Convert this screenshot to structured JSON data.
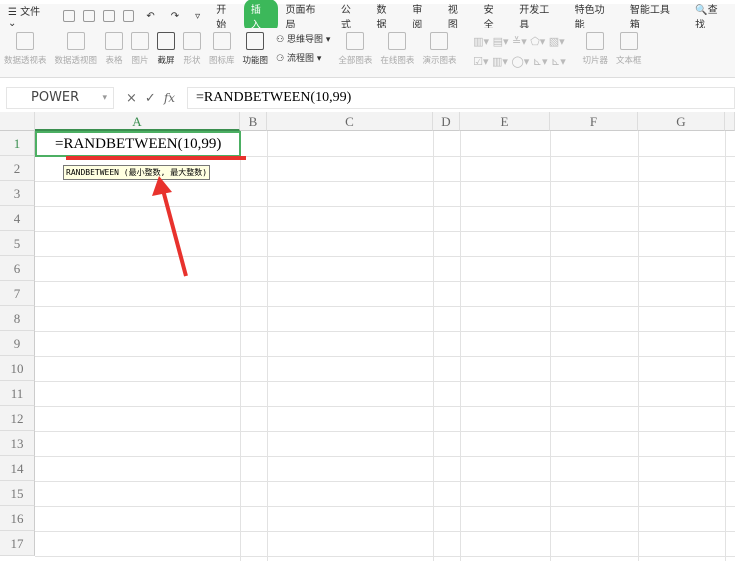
{
  "menu": {
    "file": "文件",
    "tabs": [
      "开始",
      "插入",
      "页面布局",
      "公式",
      "数据",
      "审阅",
      "视图",
      "安全",
      "开发工具",
      "特色功能",
      "智能工具箱"
    ],
    "active_tab": "插入",
    "search": "查找"
  },
  "ribbon": {
    "items": [
      "数据透视表",
      "数据透视图",
      "表格",
      "图片",
      "截屏",
      "形状",
      "图标库",
      "功能图"
    ],
    "mind_map": "思维导图",
    "flowchart": "流程图",
    "chart_items": [
      "全部图表",
      "在线图表",
      "演示图表"
    ],
    "slicer": "切片器",
    "textbox": "文本框"
  },
  "formula_bar": {
    "name_box": "POWER",
    "cancel": "×",
    "confirm": "✓",
    "fx": "fx",
    "formula": "=RANDBETWEEN(10,99)"
  },
  "columns": [
    "A",
    "B",
    "C",
    "D",
    "E",
    "F",
    "G"
  ],
  "rows": [
    "1",
    "2",
    "3",
    "4",
    "5",
    "6",
    "7",
    "8",
    "9",
    "10",
    "11",
    "12",
    "13",
    "14",
    "15",
    "16",
    "17"
  ],
  "cell_a1": "=RANDBETWEEN(10,99)",
  "tooltip": "RANDBETWEEN (最小整数, 最大整数)",
  "colors": {
    "accent": "#3cb85a",
    "annotation": "#e8322d"
  }
}
